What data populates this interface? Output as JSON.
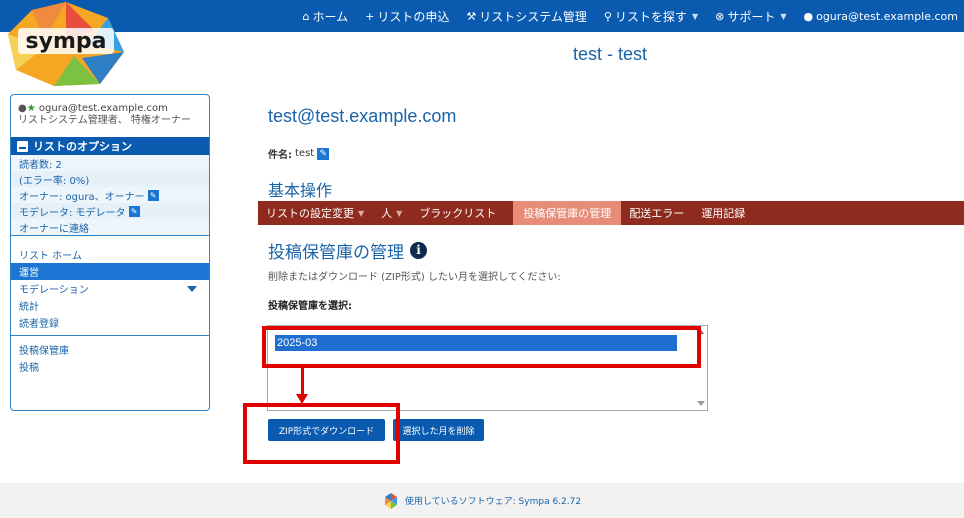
{
  "brand": {
    "logo_text": "sympa"
  },
  "topnav": {
    "home": "ホーム",
    "request_list": "リストの申込",
    "list_admin": "リストシステム管理",
    "search_list": "リストを探す",
    "support": "サポート",
    "user": "ogura@test.example.com"
  },
  "page_title": "test - test",
  "sidebar": {
    "user_email": "ogura@test.example.com",
    "user_roles": "リストシステム管理者、 特権オーナー",
    "options_header": "リストのオプション",
    "subscribers": "読者数: 2",
    "error_rate": "(エラー率: 0%)",
    "owners": "オーナー: ogura、オーナー",
    "moderators": "モデレータ: モデレータ",
    "contact_owner": "オーナーに連絡",
    "nav1": [
      "リスト ホーム",
      "運営",
      "モデレーション",
      "統計",
      "読者登録"
    ],
    "active_index": 1,
    "nav2": [
      "投稿保管庫",
      "投稿"
    ]
  },
  "main": {
    "list_address": "test@test.example.com",
    "subject_label": "件名:",
    "subject_value": "test",
    "section_title": "基本操作",
    "tabs": [
      "リストの設定変更",
      "人",
      "ブラックリスト",
      "投稿保管庫の管理",
      "配送エラー",
      "運用記録"
    ],
    "active_tab": "投稿保管庫の管理",
    "manage_title": "投稿保管庫の管理",
    "instruction": "削除またはダウンロード (ZIP形式) したい月を選択してください:",
    "select_label": "投稿保管庫を選択:",
    "archive_months": [
      "2025-03"
    ],
    "selected_month": "2025-03",
    "zip_button": "ZIP形式でダウンロード",
    "delete_button": "選択した月を削除"
  },
  "footer": {
    "text": "使用しているソフトウェア: Sympa 6.2.72"
  },
  "colors": {
    "topbar": "#0a5bb0",
    "tabbar": "#8e2b1e",
    "active_tab": "#e88c7a",
    "button": "#0a5bb0",
    "annotation": "#e00000"
  }
}
